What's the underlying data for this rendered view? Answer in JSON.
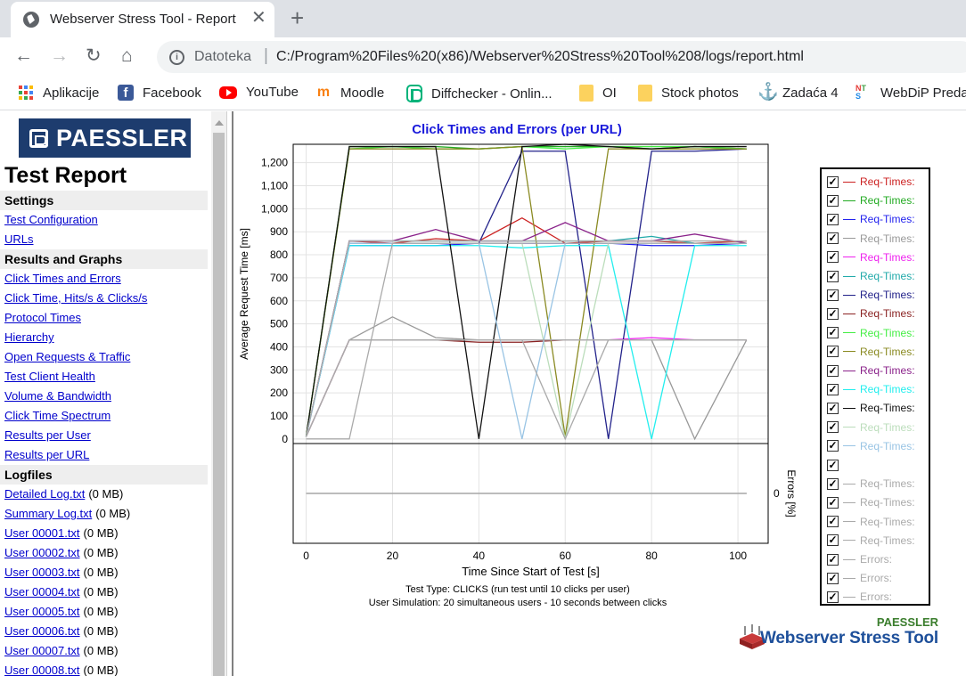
{
  "browser": {
    "tab_title": "Webserver Stress Tool - Report",
    "omnibox_label": "Datoteka",
    "url": "C:/Program%20Files%20(x86)/Webserver%20Stress%20Tool%208/logs/report.html"
  },
  "bookmarks": [
    {
      "label": "Aplikacije",
      "icon": "apps-icon"
    },
    {
      "label": "Facebook",
      "icon": "facebook-icon"
    },
    {
      "label": "YouTube",
      "icon": "youtube-icon"
    },
    {
      "label": "Moodle",
      "icon": "moodle-icon"
    },
    {
      "label": "Diffchecker - Onlin...",
      "icon": "diffchecker-icon"
    },
    {
      "label": "OI",
      "icon": "folder-icon"
    },
    {
      "label": "Stock photos",
      "icon": "folder-icon"
    },
    {
      "label": "Zadaća 4",
      "icon": "anchor-icon"
    },
    {
      "label": "WebDiP Preda",
      "icon": "nts-icon"
    }
  ],
  "sidebar": {
    "logo_text": "PAESSLER",
    "title": "Test Report",
    "sections": [
      {
        "heading": "Settings",
        "links": [
          {
            "label": "Test Configuration"
          },
          {
            "label": "URLs"
          }
        ]
      },
      {
        "heading": "Results and Graphs",
        "links": [
          {
            "label": "Click Times and Errors"
          },
          {
            "label": "Click Time, Hits/s & Clicks/s"
          },
          {
            "label": "Protocol Times"
          },
          {
            "label": "Hierarchy"
          },
          {
            "label": "Open Requests & Traffic"
          },
          {
            "label": "Test Client Health"
          },
          {
            "label": "Volume & Bandwidth"
          },
          {
            "label": "Click Time Spectrum"
          },
          {
            "label": "Results per User"
          },
          {
            "label": "Results per URL"
          }
        ]
      },
      {
        "heading": "Logfiles",
        "links": [
          {
            "label": "Detailed Log.txt",
            "size": "(0 MB)"
          },
          {
            "label": "Summary Log.txt",
            "size": "(0 MB)"
          },
          {
            "label": "User 00001.txt",
            "size": "(0 MB)"
          },
          {
            "label": "User 00002.txt",
            "size": "(0 MB)"
          },
          {
            "label": "User 00003.txt",
            "size": "(0 MB)"
          },
          {
            "label": "User 00004.txt",
            "size": "(0 MB)"
          },
          {
            "label": "User 00005.txt",
            "size": "(0 MB)"
          },
          {
            "label": "User 00006.txt",
            "size": "(0 MB)"
          },
          {
            "label": "User 00007.txt",
            "size": "(0 MB)"
          },
          {
            "label": "User 00008.txt",
            "size": "(0 MB)"
          }
        ]
      }
    ]
  },
  "report": {
    "test_type": "Test Type: CLICKS (run test until 10 clicks per user)",
    "user_simulation": "User Simulation: 20 simultaneous users - 10 seconds between clicks",
    "brand_small": "PAESSLER",
    "brand_big": "Webserver Stress Tool"
  },
  "colors": {
    "chart_title": "#1a1adb",
    "link": "#0000cc"
  },
  "chart_data": {
    "type": "line",
    "title": "Click Times and Errors (per URL)",
    "xlabel": "Time Since Start of Test [s]",
    "ylabel": "Average Request Time [ms]",
    "y2label": "Errors [%]",
    "xlim": [
      -3,
      107
    ],
    "ylim": [
      -20,
      1280
    ],
    "x_ticks": [
      "0",
      "20",
      "40",
      "60",
      "80",
      "100"
    ],
    "y_ticks": [
      "0",
      "100",
      "200",
      "300",
      "400",
      "500",
      "600",
      "700",
      "800",
      "900",
      "1,000",
      "1,100",
      "1,200"
    ],
    "errors_tick": "0",
    "grid": true,
    "legend_position": "right",
    "series": [
      {
        "name": "Req-Times:",
        "color": "#cc2222",
        "x": [
          0,
          10,
          20,
          30,
          40,
          50,
          60,
          70,
          80,
          90,
          102
        ],
        "values": [
          10,
          860,
          850,
          870,
          860,
          960,
          850,
          860,
          860,
          850,
          860
        ]
      },
      {
        "name": "Req-Times:",
        "color": "#22aa22",
        "x": [
          0,
          10,
          20,
          30,
          40,
          50,
          60,
          70,
          80,
          90,
          102
        ],
        "values": [
          10,
          1270,
          1270,
          1270,
          1260,
          1270,
          1270,
          1270,
          1260,
          1270,
          1260
        ]
      },
      {
        "name": "Req-Times:",
        "color": "#2222ee",
        "x": [
          0,
          10,
          20,
          30,
          40,
          50,
          60,
          70,
          80,
          90,
          102
        ],
        "values": [
          10,
          840,
          840,
          840,
          850,
          850,
          850,
          850,
          840,
          840,
          850
        ]
      },
      {
        "name": "Req-Times:",
        "color": "#999999",
        "x": [
          0,
          10,
          20,
          30,
          40,
          50,
          60,
          70,
          80,
          90,
          102
        ],
        "values": [
          10,
          430,
          530,
          440,
          430,
          430,
          430,
          430,
          430,
          0,
          430
        ]
      },
      {
        "name": "Req-Times:",
        "color": "#ee22ee",
        "x": [
          0,
          10,
          20,
          30,
          40,
          50,
          60,
          70,
          80,
          90,
          102
        ],
        "values": [
          10,
          430,
          430,
          430,
          430,
          430,
          430,
          430,
          440,
          430,
          430
        ]
      },
      {
        "name": "Req-Times:",
        "color": "#22aaaa",
        "x": [
          0,
          10,
          20,
          30,
          40,
          50,
          60,
          70,
          80,
          90,
          102
        ],
        "values": [
          10,
          860,
          860,
          860,
          860,
          860,
          860,
          860,
          880,
          850,
          850
        ]
      },
      {
        "name": "Req-Times:",
        "color": "#22228a",
        "x": [
          0,
          10,
          20,
          30,
          40,
          50,
          60,
          70,
          80,
          90,
          102
        ],
        "values": [
          10,
          850,
          850,
          850,
          850,
          1250,
          1250,
          0,
          1250,
          1250,
          1260
        ]
      },
      {
        "name": "Req-Times:",
        "color": "#8a2222",
        "x": [
          0,
          10,
          20,
          30,
          40,
          50,
          60,
          70,
          80,
          90,
          102
        ],
        "values": [
          10,
          430,
          430,
          430,
          420,
          420,
          430,
          430,
          430,
          430,
          430
        ]
      },
      {
        "name": "Req-Times:",
        "color": "#44ee44",
        "x": [
          0,
          10,
          20,
          30,
          40,
          50,
          60,
          70,
          80,
          90,
          102
        ],
        "values": [
          10,
          1260,
          1270,
          1260,
          1260,
          1270,
          1260,
          1270,
          1270,
          1270,
          1260
        ]
      },
      {
        "name": "Req-Times:",
        "color": "#8a8a22",
        "x": [
          0,
          10,
          20,
          30,
          40,
          50,
          60,
          70,
          80,
          90,
          102
        ],
        "values": [
          10,
          1260,
          1260,
          1260,
          1260,
          1270,
          10,
          1260,
          1260,
          1260,
          1260
        ]
      },
      {
        "name": "Req-Times:",
        "color": "#8a228a",
        "x": [
          0,
          10,
          20,
          30,
          40,
          50,
          60,
          70,
          80,
          90,
          102
        ],
        "values": [
          10,
          860,
          860,
          910,
          860,
          860,
          940,
          860,
          860,
          890,
          850
        ]
      },
      {
        "name": "Req-Times:",
        "color": "#22eeee",
        "x": [
          0,
          10,
          20,
          30,
          40,
          50,
          60,
          70,
          80,
          90,
          102
        ],
        "values": [
          10,
          840,
          840,
          840,
          840,
          830,
          840,
          840,
          0,
          840,
          840
        ]
      },
      {
        "name": "Req-Times:",
        "color": "#111111",
        "x": [
          0,
          10,
          20,
          30,
          40,
          50,
          60,
          70,
          80,
          90,
          102
        ],
        "values": [
          10,
          1270,
          1270,
          1270,
          0,
          1270,
          1280,
          1270,
          1260,
          1270,
          1270
        ]
      },
      {
        "name": "Req-Times:",
        "color": "#bbddbb",
        "x": [
          0,
          10,
          20,
          30,
          40,
          50,
          60,
          70,
          80,
          90,
          102
        ],
        "values": [
          10,
          850,
          850,
          850,
          850,
          850,
          0,
          850,
          850,
          850,
          850
        ]
      },
      {
        "name": "Req-Times:",
        "color": "#99c4e4",
        "x": [
          0,
          10,
          20,
          30,
          40,
          50,
          60,
          70,
          80,
          90,
          102
        ],
        "values": [
          10,
          850,
          850,
          850,
          850,
          0,
          850,
          850,
          850,
          850,
          850
        ]
      },
      {
        "name": "",
        "color": "#eeeeee",
        "x": [
          0,
          10,
          20,
          30,
          40,
          50,
          60,
          70,
          80,
          90,
          102
        ],
        "values": [
          10,
          430,
          430,
          430,
          430,
          430,
          430,
          430,
          430,
          430,
          430
        ]
      },
      {
        "name": "Req-Times:",
        "color": "#aaaaaa",
        "x": [
          0,
          10,
          20,
          30,
          40,
          50,
          60,
          70,
          80,
          90,
          102
        ],
        "values": [
          0,
          0,
          850,
          850,
          850,
          850,
          850,
          850,
          850,
          850,
          850
        ]
      },
      {
        "name": "Req-Times:",
        "color": "#aaaaaa",
        "x": [
          0,
          10,
          20,
          30,
          40,
          50,
          60,
          70,
          80,
          90,
          102
        ],
        "values": [
          10,
          430,
          430,
          430,
          430,
          430,
          0,
          430,
          430,
          430,
          430
        ]
      },
      {
        "name": "Req-Times:",
        "color": "#aaaaaa",
        "x": [
          0,
          10,
          20,
          30,
          40,
          50,
          60,
          70,
          80,
          90,
          102
        ],
        "values": [
          10,
          430,
          430,
          430,
          430,
          430,
          430,
          430,
          430,
          430,
          430
        ]
      },
      {
        "name": "Req-Times:",
        "color": "#aaaaaa",
        "x": [
          0,
          10,
          20,
          30,
          40,
          50,
          60,
          70,
          80,
          90,
          102
        ],
        "values": [
          10,
          860,
          860,
          860,
          860,
          860,
          860,
          860,
          860,
          860,
          860
        ]
      },
      {
        "name": "Errors:",
        "color": "#aaaaaa",
        "panel": "errors",
        "x": [
          0,
          102
        ],
        "values": [
          0,
          0
        ]
      },
      {
        "name": "Errors:",
        "color": "#aaaaaa",
        "panel": "errors",
        "x": [
          0,
          102
        ],
        "values": [
          0,
          0
        ]
      },
      {
        "name": "Errors:",
        "color": "#aaaaaa",
        "panel": "errors",
        "x": [
          0,
          102
        ],
        "values": [
          0,
          0
        ]
      }
    ]
  }
}
